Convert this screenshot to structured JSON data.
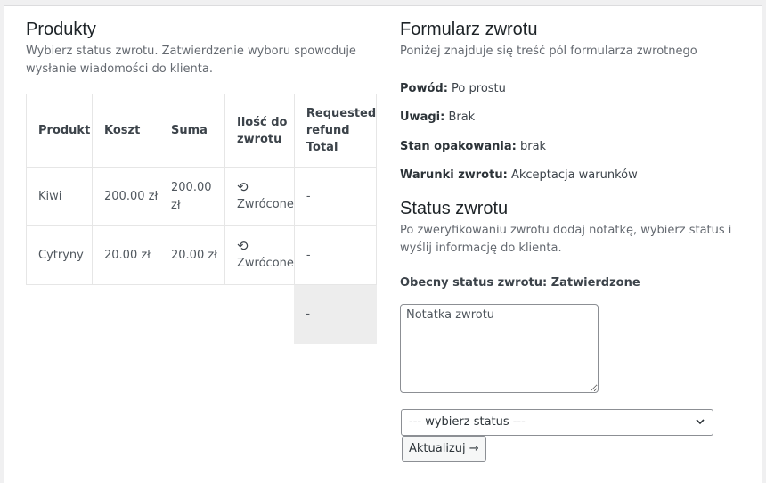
{
  "products": {
    "title": "Produkty",
    "description": "Wybierz status zwrotu. Zatwierdzenie wyboru spowoduje wysłanie wiadomości do klienta.",
    "headers": [
      "Produkt",
      "Koszt",
      "Suma",
      "Ilość do zwrotu",
      "Requested refund Total"
    ],
    "rows": [
      {
        "name": "Kiwi",
        "cost": "200.00 zł",
        "sum": "200.00 zł",
        "return_status": "Zwrócone",
        "refund": "-"
      },
      {
        "name": "Cytryny",
        "cost": "20.00 zł",
        "sum": "20.00 zł",
        "return_status": "Zwrócone",
        "refund": "-"
      }
    ],
    "total": "-"
  },
  "form": {
    "title": "Formularz zwrotu",
    "description": "Poniżej znajduje się treść pól formularza zwrotnego",
    "fields": [
      {
        "label": "Powód:",
        "value": "Po prostu"
      },
      {
        "label": "Uwagi:",
        "value": "Brak"
      },
      {
        "label": "Stan opakowania:",
        "value": "brak"
      },
      {
        "label": "Warunki zwrotu:",
        "value": "Akceptacja warunków"
      }
    ]
  },
  "status": {
    "title": "Status zwrotu",
    "description": "Po zweryfikowaniu zwrotu dodaj notatkę, wybierz status i wyślij informację do klienta.",
    "current_label": "Obecny status zwrotu: Zatwierdzone",
    "note_placeholder": "Notatka zwrotu",
    "select_value": "--- wybierz status ---",
    "update_button": "Aktualizuj →"
  },
  "icons": {
    "undo": "undo-icon",
    "chevron": "chevron-down-icon"
  }
}
